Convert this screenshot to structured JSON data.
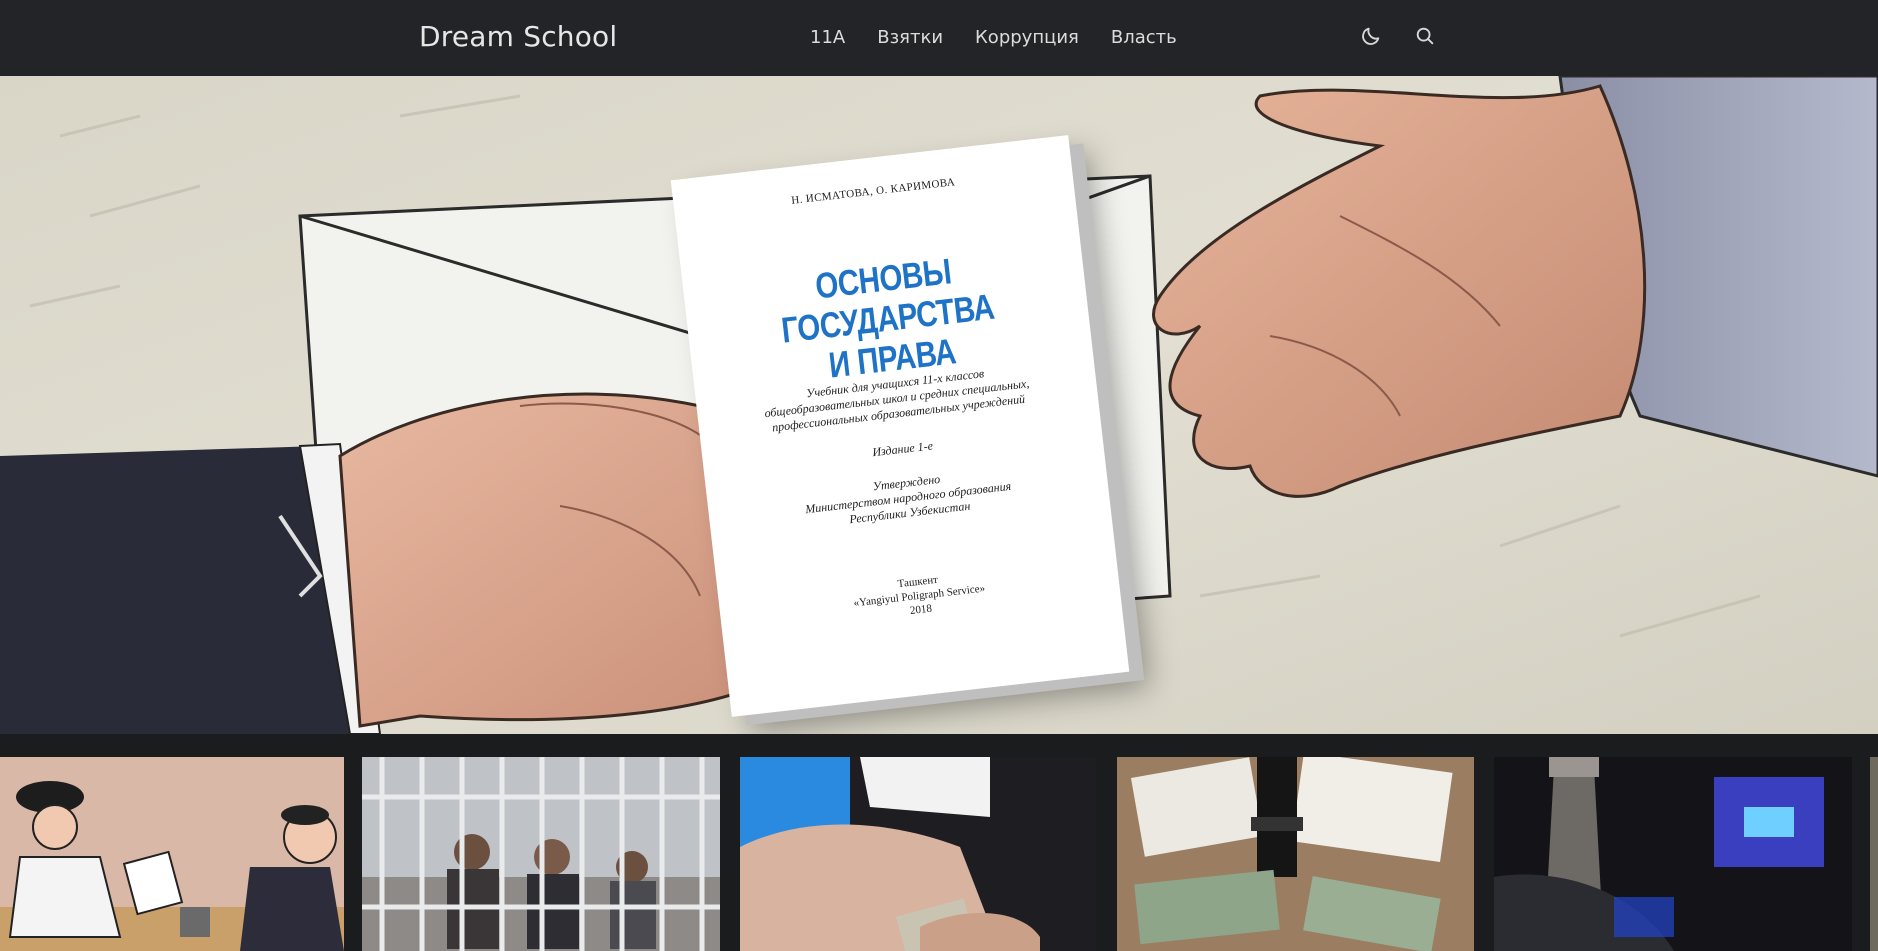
{
  "header": {
    "logo": "Dream School",
    "nav": [
      {
        "label": "11A"
      },
      {
        "label": "Взятки"
      },
      {
        "label": "Коррупция"
      },
      {
        "label": "Власть"
      }
    ],
    "icons": [
      "moon-icon",
      "search-icon"
    ]
  },
  "hero": {
    "book": {
      "authors": "Н. ИСМАТОВА, О. КАРИМОВА",
      "title_line1": "ОСНОВЫ ГОСУДАРСТВА",
      "title_line2": "И ПРАВА",
      "subtitle_line1": "Учебник для учащихся 11-х классов",
      "subtitle_line2": "общеобразовательных школ и средних специальных,",
      "subtitle_line3": "профессиональных образовательных учреждений",
      "edition": "Издание 1-е",
      "approved_line1": "Утверждено",
      "approved_line2": "Министерством народного образования",
      "approved_line3": "Республики Узбекистан",
      "city": "Ташкент",
      "publisher": "«Yangiyul Poligraph Service»",
      "year": "2018"
    }
  },
  "thumbnails": [
    {
      "name": "thumbnail-cartoon-bribe"
    },
    {
      "name": "thumbnail-courtroom-cage"
    },
    {
      "name": "thumbnail-cash-handover"
    },
    {
      "name": "thumbnail-seized-money"
    },
    {
      "name": "thumbnail-dark-scene"
    }
  ],
  "colors": {
    "header_bg": "#232427",
    "page_bg": "#1b1c1e",
    "book_title": "#1f73c6",
    "nav_text": "#dcdcdc"
  }
}
